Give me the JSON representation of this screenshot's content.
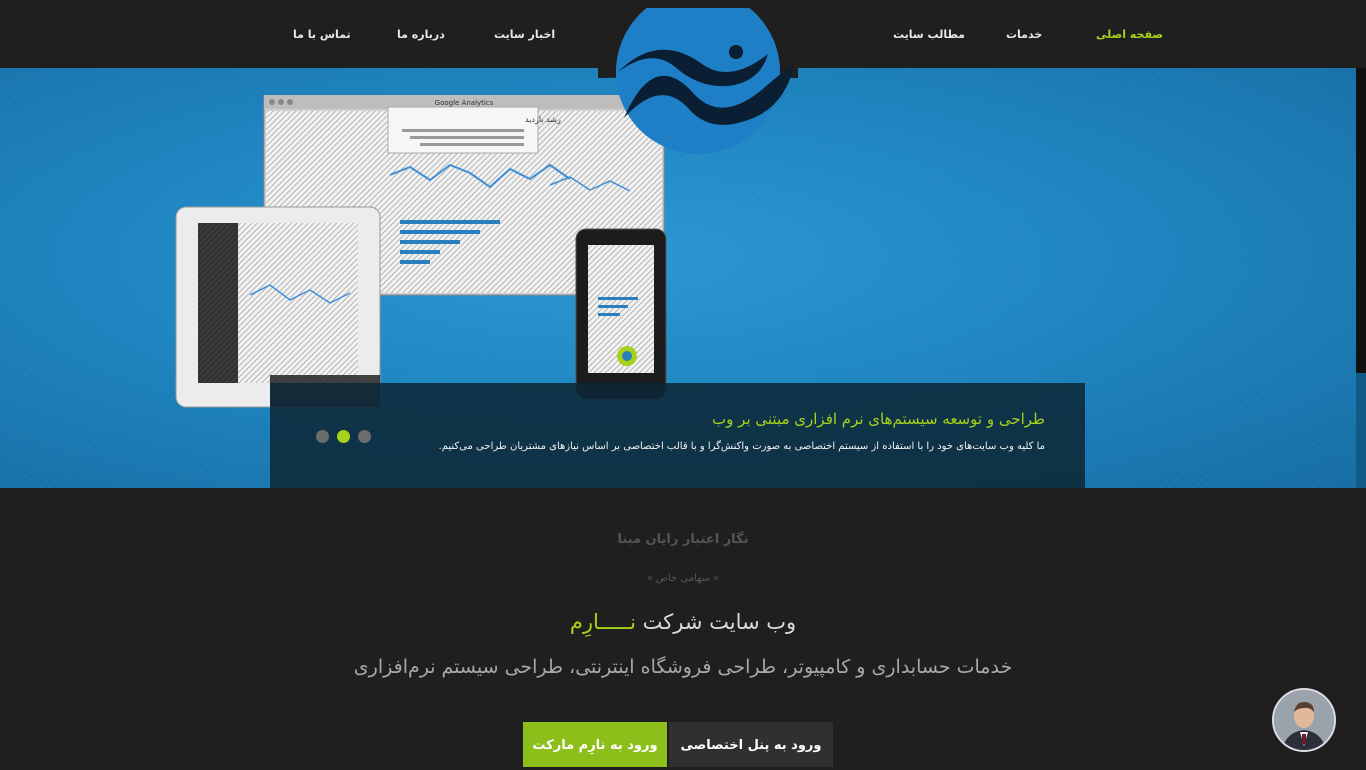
{
  "nav": {
    "items": [
      {
        "label": "صفحه اصلی",
        "active": true
      },
      {
        "label": "خدمات",
        "active": false
      },
      {
        "label": "مطالب سایت",
        "active": false
      },
      {
        "label": "اخبار سایت",
        "active": false
      },
      {
        "label": "درباره ما",
        "active": false
      },
      {
        "label": "تماس با ما",
        "active": false
      }
    ]
  },
  "logo": {
    "icon": "fish-wave-logo",
    "color": "#1e7fc6"
  },
  "hero": {
    "slide_title": "طراحی و توسعه سیستم‌های نرم افزاری مبتنی بر وب",
    "slide_text": "ما کلیه وب سایت‌های خود را با استفاده از سیستم اختصاصی به صورت واکنش‌گرا و با قالب اختصاصی بر اساس نیازهای مشتریان طراحی می‌کنیم.",
    "active_slide": 2,
    "slide_count": 3,
    "screen_title": "Google Analytics",
    "popup_title": "رشد بازدید"
  },
  "intro": {
    "company": "نگار اعتبار رایان مبنا",
    "company_type": "« سهامی خاص »",
    "site_title_prefix": "وب سایت شرکت",
    "brand": "نـــــارِم",
    "services": "خدمات حسابداری و کامپیوتر، طراحی فروشگاه اینترنتی، طراحی سیستم نرم‌افزاری"
  },
  "buttons": {
    "panel": "ورود به پنل اختصاصی",
    "market": "ورود به نارِم مارکت"
  },
  "colors": {
    "accent": "#a7d11b",
    "hero_blue": "#1f86c2",
    "dark": "#1f1f1f",
    "button_green": "#8cbf19"
  },
  "chat": {
    "icon": "support-avatar"
  }
}
